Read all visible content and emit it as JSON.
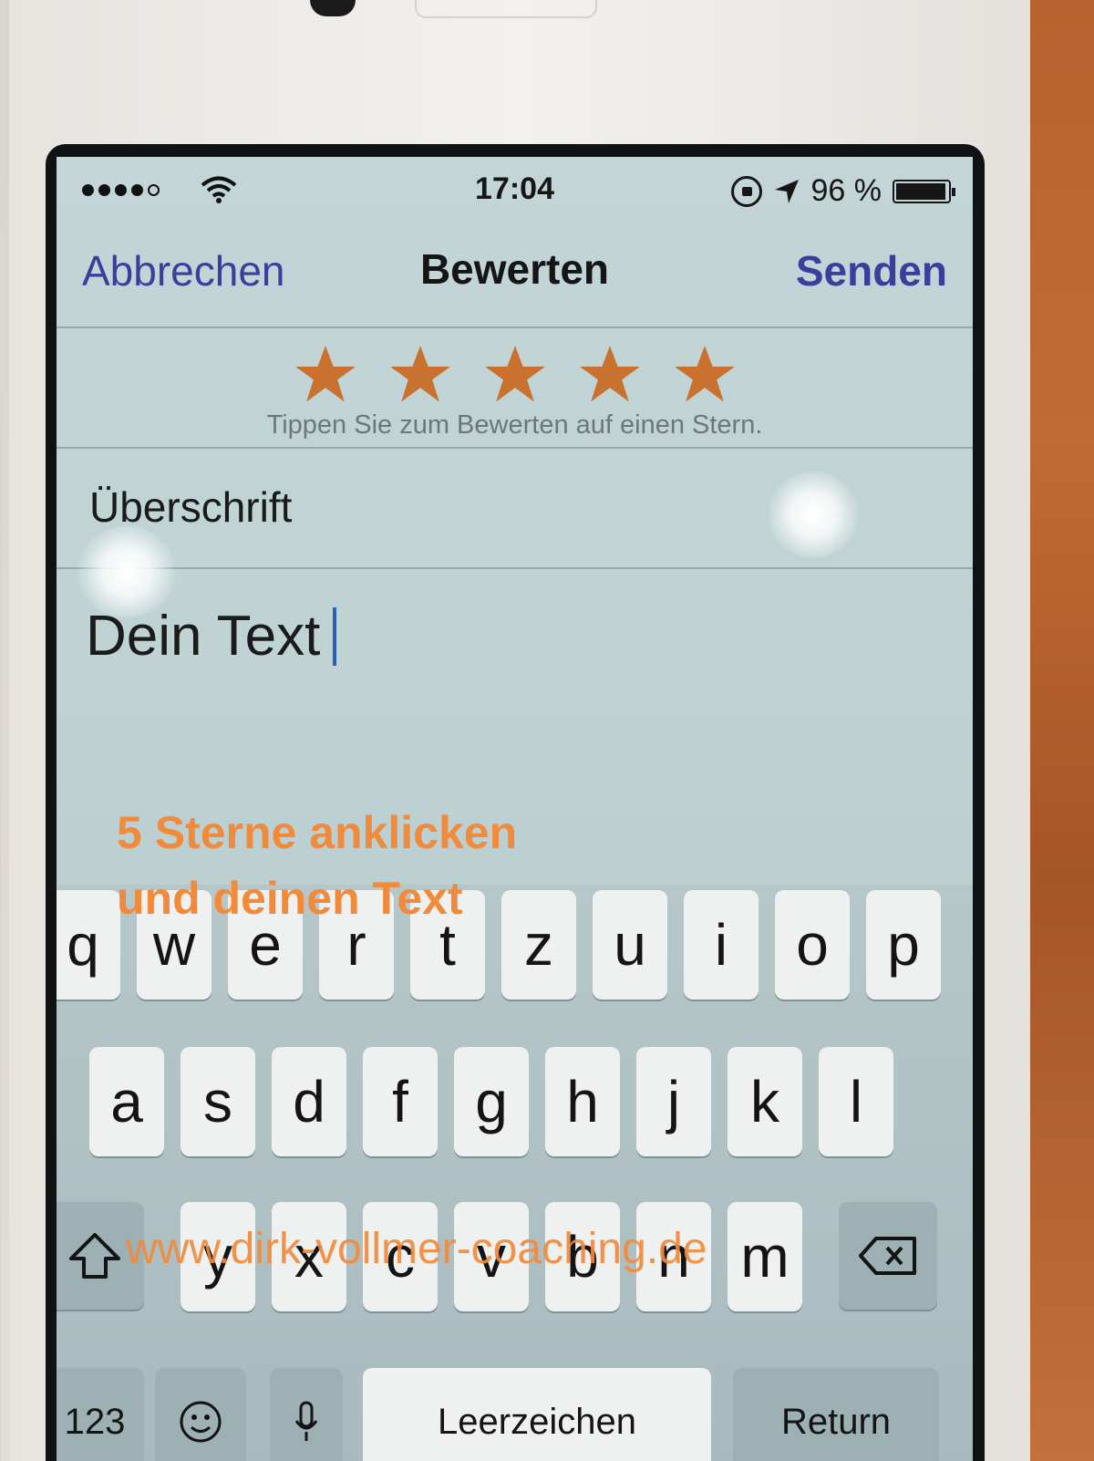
{
  "status_bar": {
    "time": "17:04",
    "battery_percent": "96 %"
  },
  "nav": {
    "cancel": "Abbrechen",
    "title": "Bewerten",
    "send": "Senden"
  },
  "rating": {
    "stars_filled": 5,
    "stars_total": 5,
    "hint": "Tippen Sie zum Bewerten auf einen Stern.",
    "star_color": "#c9722f"
  },
  "title_field": {
    "placeholder": "Überschrift"
  },
  "body_field": {
    "value": "Dein Text"
  },
  "overlay": {
    "caption_line1": "5 Sterne anklicken",
    "caption_line2": "und deinen Text",
    "watermark": "www.dirk-vollmer-coaching.de"
  },
  "keyboard": {
    "row1": [
      "q",
      "w",
      "e",
      "r",
      "t",
      "z",
      "u",
      "i",
      "o",
      "p"
    ],
    "row2": [
      "a",
      "s",
      "d",
      "f",
      "g",
      "h",
      "j",
      "k",
      "l"
    ],
    "row3": [
      "y",
      "x",
      "c",
      "v",
      "b",
      "n",
      "m"
    ],
    "numbers": "123",
    "space": "Leerzeichen",
    "return": "Return"
  },
  "colors": {
    "accent_blue": "#3b3f9c",
    "overlay_orange": "#f28a3c"
  }
}
